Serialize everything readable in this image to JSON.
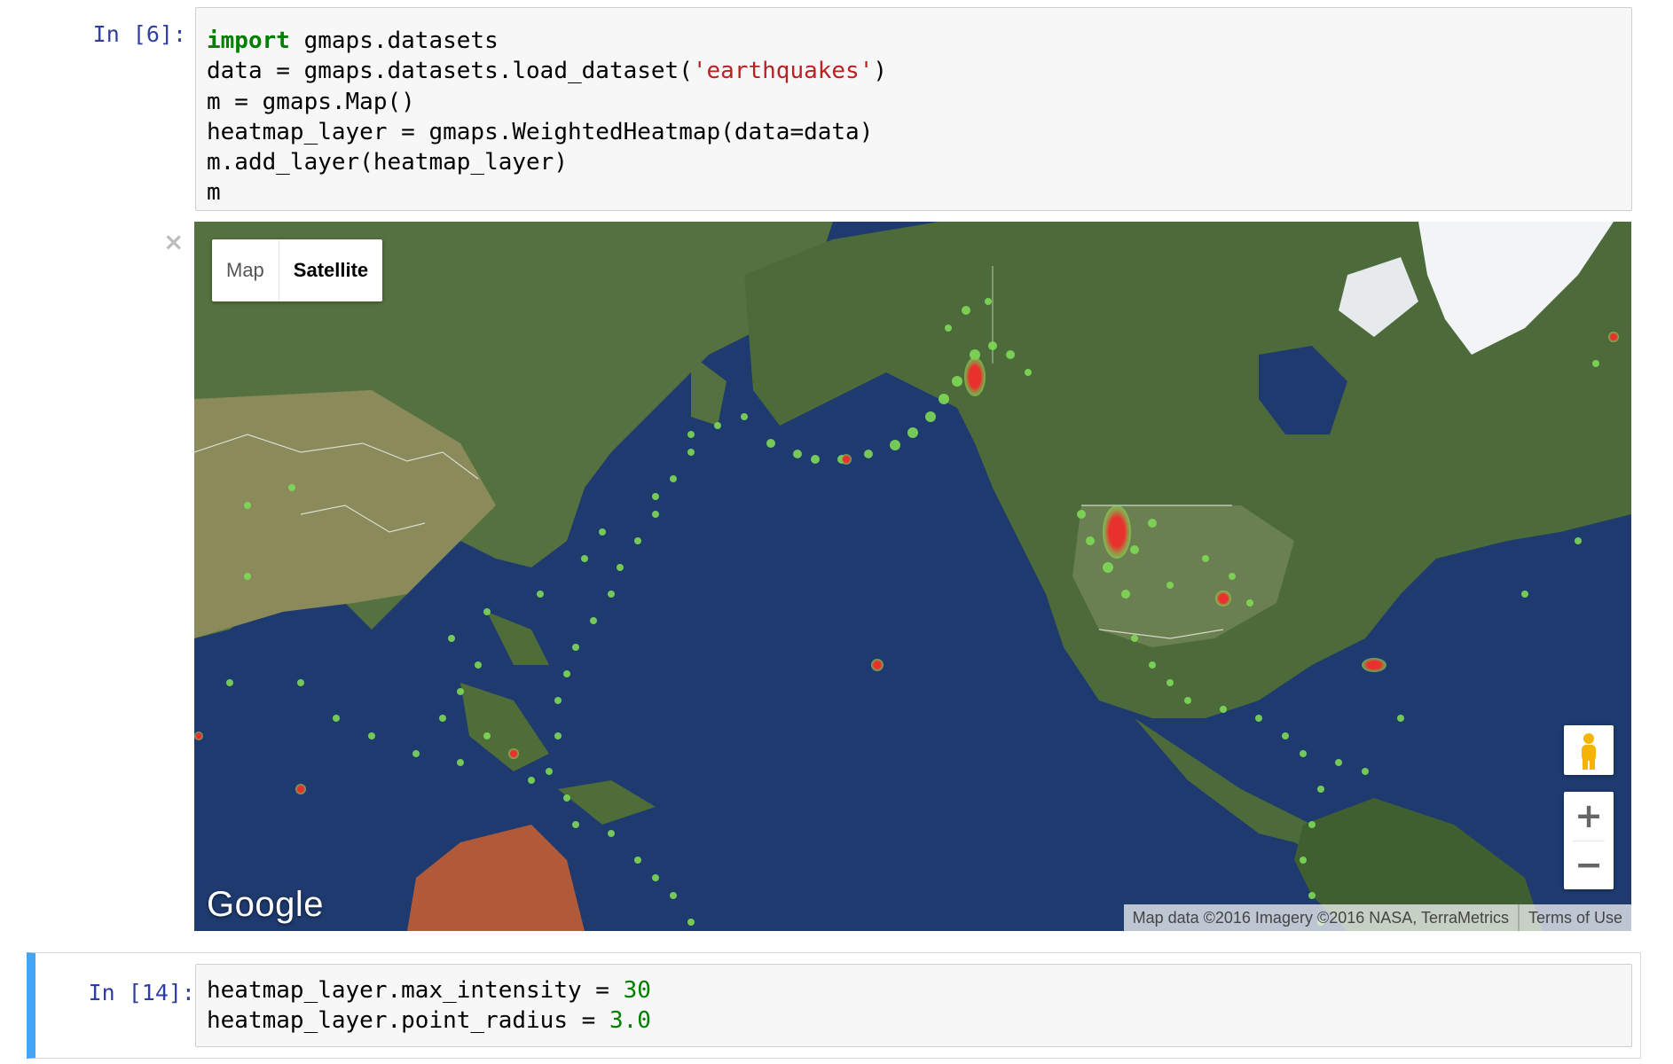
{
  "cell1": {
    "prompt": "In [6]:",
    "code": {
      "line1_kw": "import",
      "line1_rest": " gmaps.datasets",
      "line2_pre": "data = gmaps.datasets.load_dataset(",
      "line2_str": "'earthquakes'",
      "line2_post": ")",
      "line3": "m = gmaps.Map()",
      "line4": "heatmap_layer = gmaps.WeightedHeatmap(data=data)",
      "line5": "m.add_layer(heatmap_layer)",
      "line6": "m"
    },
    "close_symbol": "×"
  },
  "map": {
    "type_controls": [
      "Map",
      "Satellite"
    ],
    "selected_type": "Satellite",
    "logo": "Google",
    "attribution": "Map data ©2016 Imagery ©2016 NASA, TerraMetrics",
    "terms": "Terms of Use",
    "zoom_in": "+",
    "zoom_out": "−",
    "colors": {
      "ocean": "#1e3a6e",
      "land": "#4d6b3a",
      "ice": "#f2f4f5",
      "heat_low": "#7ed957",
      "heat_high": "#e8302c"
    }
  },
  "cell2": {
    "prompt": "In [14]:",
    "line1_pre": "heatmap_layer.max_intensity = ",
    "line1_num": "30",
    "line2_pre": "heatmap_layer.point_radius = ",
    "line2_num": "3.0"
  }
}
